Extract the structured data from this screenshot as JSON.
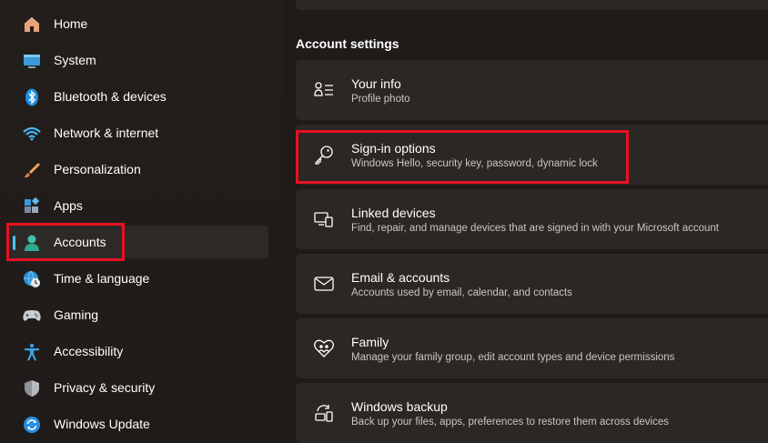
{
  "sidebar": {
    "items": [
      {
        "label": "Home",
        "icon": "home-icon"
      },
      {
        "label": "System",
        "icon": "monitor-icon"
      },
      {
        "label": "Bluetooth & devices",
        "icon": "bluetooth-icon"
      },
      {
        "label": "Network & internet",
        "icon": "wifi-icon"
      },
      {
        "label": "Personalization",
        "icon": "paintbrush-icon"
      },
      {
        "label": "Apps",
        "icon": "apps-icon"
      },
      {
        "label": "Accounts",
        "icon": "person-icon",
        "selected": true
      },
      {
        "label": "Time & language",
        "icon": "globe-clock-icon"
      },
      {
        "label": "Gaming",
        "icon": "gamepad-icon"
      },
      {
        "label": "Accessibility",
        "icon": "accessibility-icon"
      },
      {
        "label": "Privacy & security",
        "icon": "shield-icon"
      },
      {
        "label": "Windows Update",
        "icon": "update-icon"
      }
    ]
  },
  "main": {
    "section_title": "Account settings",
    "cards": [
      {
        "title": "Your info",
        "subtitle": "Profile photo",
        "icon": "person-list-icon"
      },
      {
        "title": "Sign-in options",
        "subtitle": "Windows Hello, security key, password, dynamic lock",
        "icon": "key-icon"
      },
      {
        "title": "Linked devices",
        "subtitle": "Find, repair, and manage devices that are signed in with your Microsoft account",
        "icon": "devices-icon"
      },
      {
        "title": "Email & accounts",
        "subtitle": "Accounts used by email, calendar, and contacts",
        "icon": "mail-icon"
      },
      {
        "title": "Family",
        "subtitle": "Manage your family group, edit account types and device permissions",
        "icon": "heart-family-icon"
      },
      {
        "title": "Windows backup",
        "subtitle": "Back up your files, apps, preferences to restore them across devices",
        "icon": "backup-icon"
      }
    ]
  },
  "colors": {
    "accent": "#4cc2ff",
    "highlight": "#e81123",
    "background": "#1f1b19",
    "card": "#2b2724"
  }
}
